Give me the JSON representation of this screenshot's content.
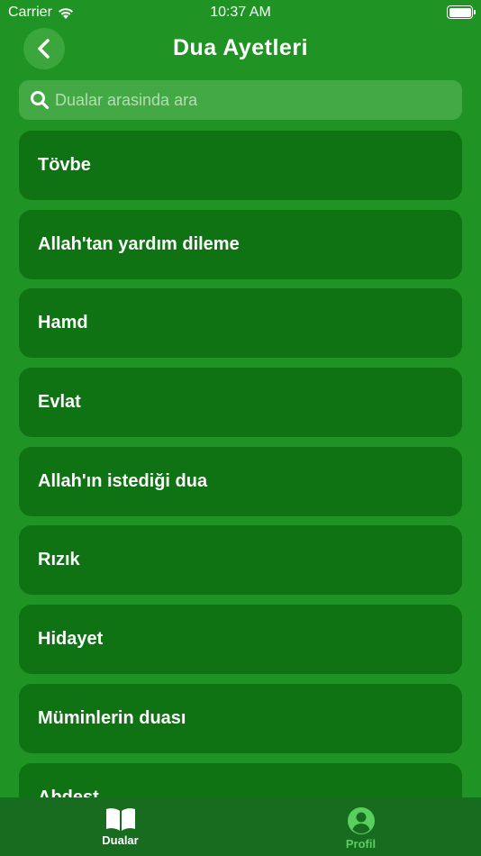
{
  "status_bar": {
    "carrier": "Carrier",
    "time": "10:37 AM"
  },
  "header": {
    "title": "Dua Ayetleri",
    "back_icon": "chevron-left-icon"
  },
  "search": {
    "placeholder": "Dualar arasinda ara",
    "value": ""
  },
  "list": {
    "items": [
      {
        "label": "Tövbe"
      },
      {
        "label": "Allah'tan yardım dileme"
      },
      {
        "label": "Hamd"
      },
      {
        "label": "Evlat"
      },
      {
        "label": "Allah'ın istediği dua"
      },
      {
        "label": "Rızık"
      },
      {
        "label": "Hidayet"
      },
      {
        "label": "Müminlerin duası"
      },
      {
        "label": "Abdest"
      }
    ]
  },
  "tab_bar": {
    "tabs": [
      {
        "label": "Dualar",
        "icon": "book-icon",
        "active": true
      },
      {
        "label": "Profil",
        "icon": "person-icon",
        "active": false
      }
    ]
  },
  "colors": {
    "background": "#1f9324",
    "card": "#0f7213",
    "tab_bar": "#186c1f",
    "inactive_tab": "#59d05d"
  }
}
